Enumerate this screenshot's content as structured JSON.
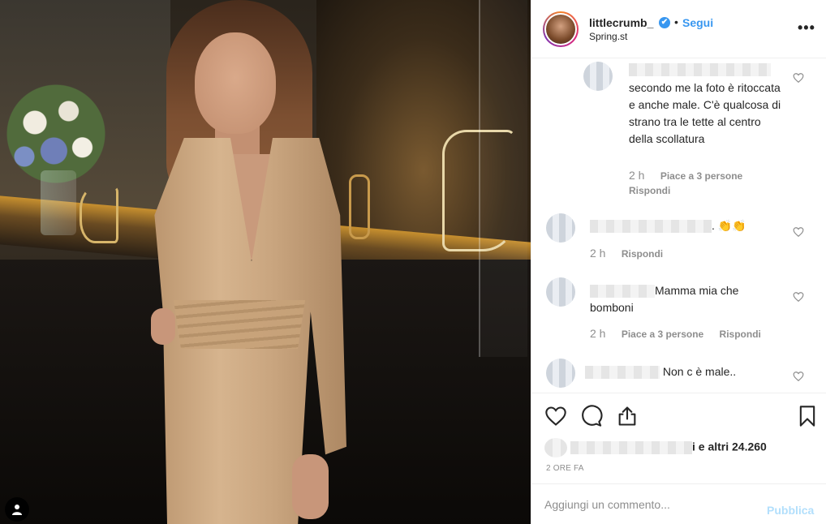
{
  "header": {
    "username": "littlecrumb_",
    "verified_mark": "✔",
    "dot": "•",
    "follow_label": "Segui",
    "location": "Spring.st",
    "more_label": "•••"
  },
  "comments": [
    {
      "text": "secondo me la foto è ritoccata e anche male. C'è qualcosa di strano tra le tette al centro della scollatura",
      "time": "2 h",
      "likes": "Piace a 3 persone",
      "reply": "Rispondi"
    },
    {
      "text": ". 👏👏",
      "time": "2 h",
      "reply": "Rispondi"
    },
    {
      "text": "Mamma mia che bomboni",
      "time": "2 h",
      "likes": "Piace a 3 persone",
      "reply": "Rispondi"
    },
    {
      "text": "Non c è male.."
    }
  ],
  "likes_text": "i e altri 24.260",
  "time_ago": "2 ORE FA",
  "add_comment": {
    "placeholder": "Aggiungi un commento...",
    "publish_label": "Pubblica"
  },
  "colors": {
    "accent": "#3897f0",
    "publish_disabled": "#b2dffc",
    "secondary_text": "#8e8e8e"
  }
}
